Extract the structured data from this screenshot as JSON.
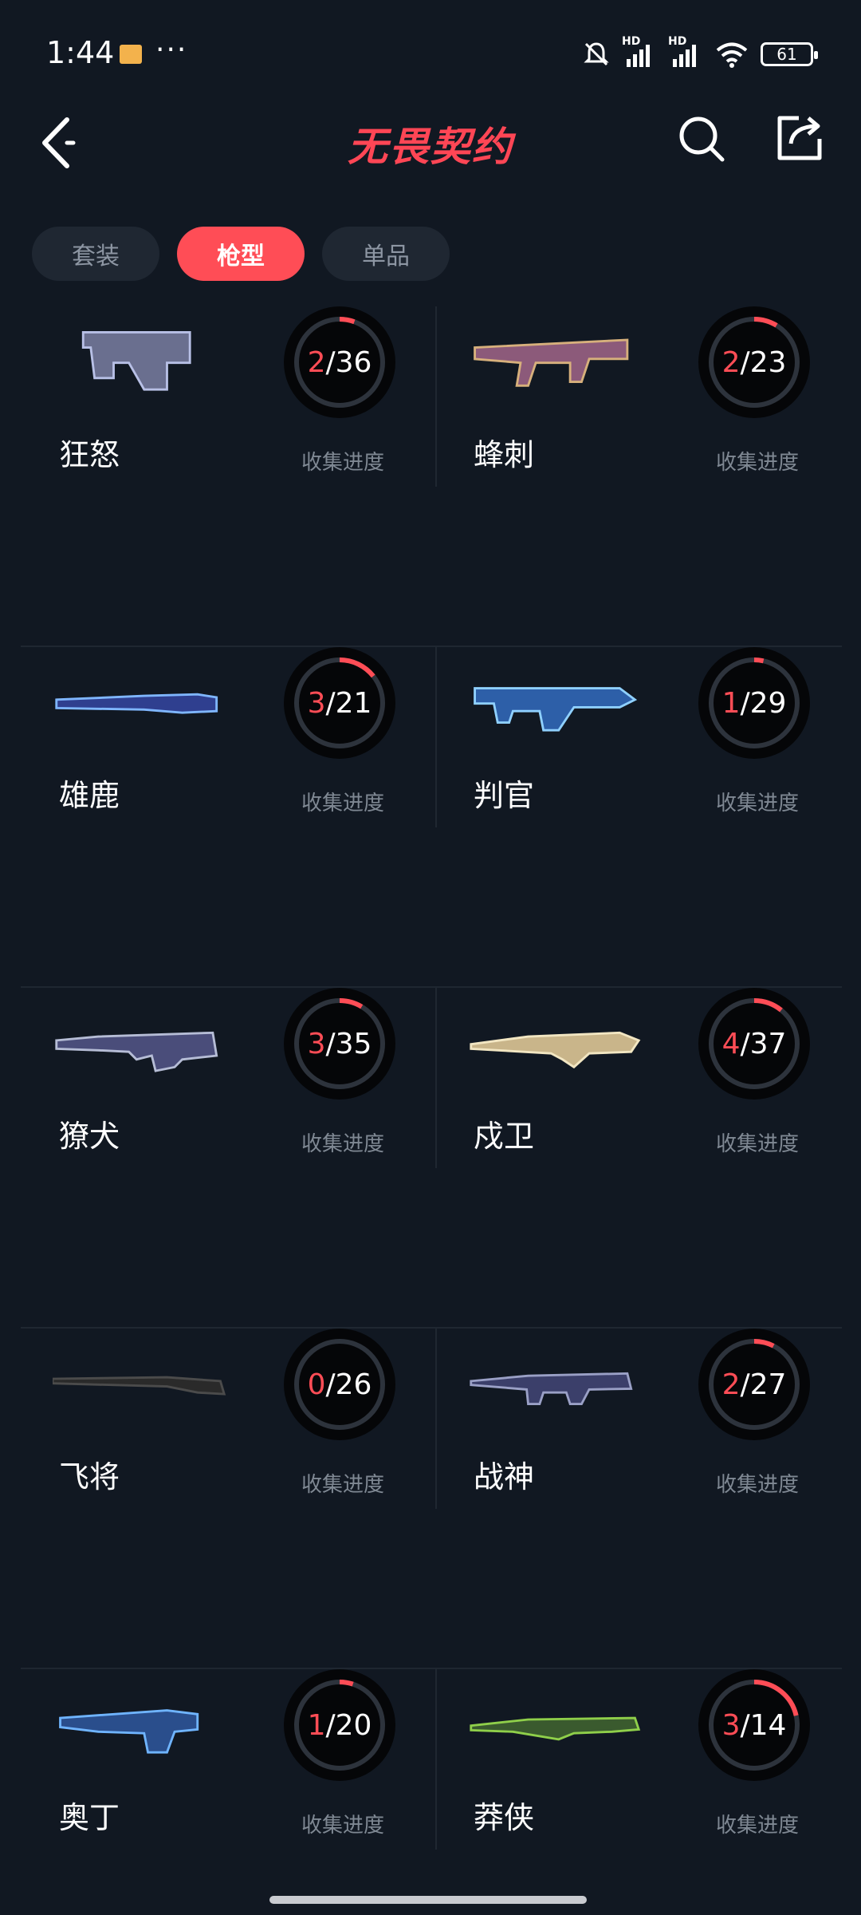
{
  "status_bar": {
    "time": "1:44",
    "more": "···",
    "signal1": "HD",
    "signal2": "HD",
    "battery": "61"
  },
  "header": {
    "title": "无畏契约"
  },
  "tabs": [
    {
      "label": "套装",
      "active": false
    },
    {
      "label": "枪型",
      "active": true
    },
    {
      "label": "单品",
      "active": false
    }
  ],
  "progress_label": "收集进度",
  "items": [
    {
      "name": "狂怒",
      "got": "2",
      "total": "/36"
    },
    {
      "name": "蜂刺",
      "got": "2",
      "total": "/23"
    },
    {
      "name": "雄鹿",
      "got": "3",
      "total": "/21"
    },
    {
      "name": "判官",
      "got": "1",
      "total": "/29"
    },
    {
      "name": "獠犬",
      "got": "3",
      "total": "/35"
    },
    {
      "name": "戍卫",
      "got": "4",
      "total": "/37"
    },
    {
      "name": "飞将",
      "got": "0",
      "total": "/26"
    },
    {
      "name": "战神",
      "got": "2",
      "total": "/27"
    },
    {
      "name": "奥丁",
      "got": "1",
      "total": "/20"
    },
    {
      "name": "莽侠",
      "got": "3",
      "total": "/14"
    }
  ],
  "colors": {
    "accent": "#ff4d56",
    "bg": "#111822",
    "ring_track": "#2d333c"
  },
  "icons": [
    "back-icon",
    "search-icon",
    "share-icon",
    "wifi-icon",
    "signal-icon",
    "mute-bell-icon",
    "battery-icon"
  ]
}
